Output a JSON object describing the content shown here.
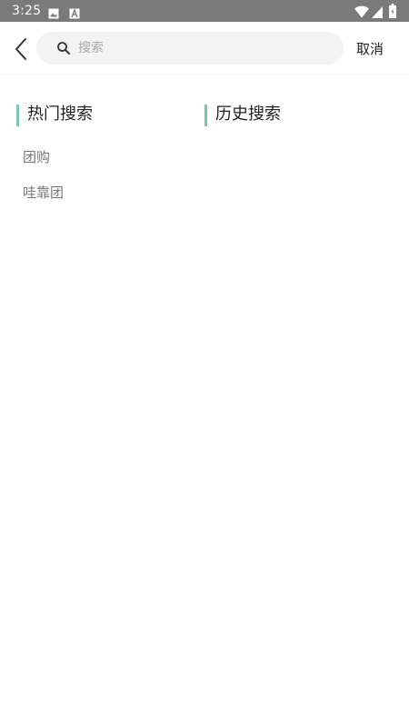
{
  "status_bar": {
    "time": "3:25",
    "icons": [
      "photo-icon",
      "a-icon",
      "wifi-icon",
      "signal-icon",
      "battery-icon"
    ]
  },
  "header": {
    "search_placeholder": "搜索",
    "search_value": "",
    "cancel_label": "取消"
  },
  "sections": {
    "hot": {
      "title": "热门搜索",
      "items": [
        "团购",
        "哇靠团"
      ]
    },
    "history": {
      "title": "历史搜索",
      "items": []
    }
  },
  "colors": {
    "status_bar": "#7a7a7a",
    "accent": "#7cc2b8",
    "search_bg": "#f3f3f3",
    "item_text": "#777777"
  }
}
